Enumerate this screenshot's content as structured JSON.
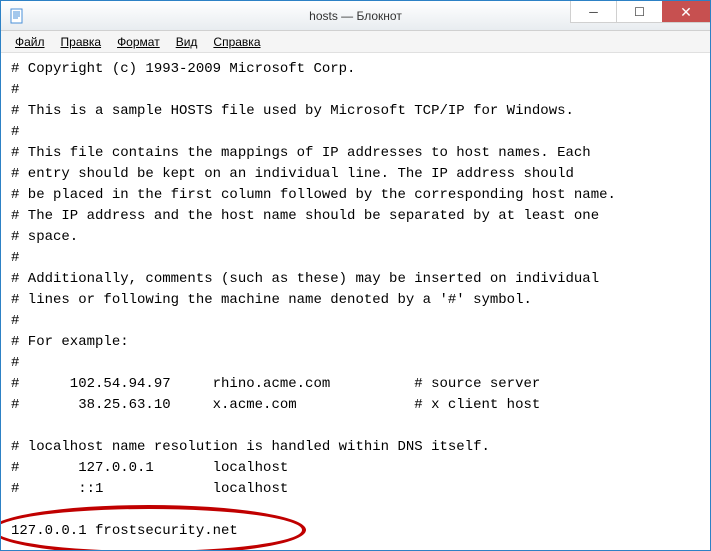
{
  "window": {
    "title": "hosts — Блокнот"
  },
  "menubar": {
    "file": "Файл",
    "edit": "Правка",
    "format": "Формат",
    "view": "Вид",
    "help": "Справка"
  },
  "file_content": {
    "l0": "# Copyright (c) 1993-2009 Microsoft Corp.",
    "l1": "#",
    "l2": "# This is a sample HOSTS file used by Microsoft TCP/IP for Windows.",
    "l3": "#",
    "l4": "# This file contains the mappings of IP addresses to host names. Each",
    "l5": "# entry should be kept on an individual line. The IP address should",
    "l6": "# be placed in the first column followed by the corresponding host name.",
    "l7": "# The IP address and the host name should be separated by at least one",
    "l8": "# space.",
    "l9": "#",
    "l10": "# Additionally, comments (such as these) may be inserted on individual",
    "l11": "# lines or following the machine name denoted by a '#' symbol.",
    "l12": "#",
    "l13": "# For example:",
    "l14": "#",
    "l15": "#      102.54.94.97     rhino.acme.com          # source server",
    "l16": "#       38.25.63.10     x.acme.com              # x client host",
    "l17": "",
    "l18": "# localhost name resolution is handled within DNS itself.",
    "l19": "#       127.0.0.1       localhost",
    "l20": "#       ::1             localhost",
    "l21": "",
    "l22": "127.0.0.1 frostsecurity.net"
  }
}
